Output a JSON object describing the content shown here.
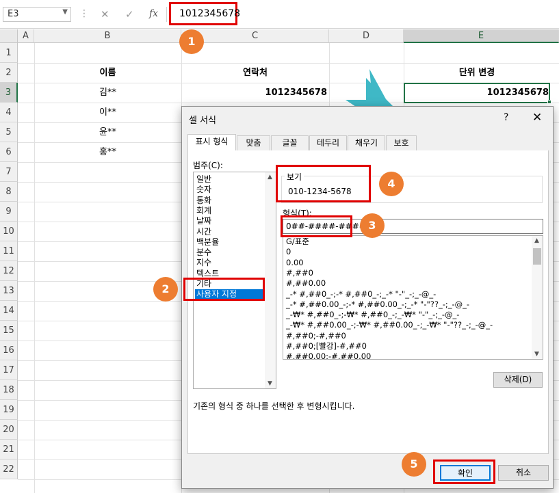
{
  "formula_bar": {
    "name_box": "E3",
    "cancel_icon": "✕",
    "confirm_icon": "✓",
    "fx_label": "fx",
    "value": "1012345678"
  },
  "sheet": {
    "columns": [
      "A",
      "B",
      "C",
      "D",
      "E"
    ],
    "selected_column": "E",
    "rows": [
      "1",
      "2",
      "3",
      "4",
      "5",
      "6",
      "7",
      "8",
      "9",
      "10",
      "11",
      "12",
      "13",
      "14",
      "15",
      "16",
      "17",
      "18",
      "19",
      "20",
      "21",
      "22"
    ],
    "selected_row": "3",
    "headers": {
      "b": "이름",
      "c": "연락처",
      "e": "단위 변경"
    },
    "names": [
      "김**",
      "이**",
      "윤**",
      "홍**"
    ],
    "c3": "1012345678",
    "e3": "1012345678",
    "arrow_color": "#3fb8c6"
  },
  "dialog": {
    "title": "셀 서식",
    "help": "?",
    "close": "✕",
    "tabs": [
      "표시 형식",
      "맞춤",
      "글꼴",
      "테두리",
      "채우기",
      "보호"
    ],
    "active_tab": "표시 형식",
    "category_label": "범주(C):",
    "categories": [
      "일반",
      "숫자",
      "통화",
      "회계",
      "날짜",
      "시간",
      "백분율",
      "분수",
      "지수",
      "텍스트",
      "기타",
      "사용자 지정"
    ],
    "selected_category": "사용자 지정",
    "sample_label": "보기",
    "sample_value": "010-1234-5678",
    "type_label": "형식(T):",
    "type_value": "0##-####-####",
    "formats": [
      "G/표준",
      "0",
      "0.00",
      "#,##0",
      "#,##0.00",
      "_-* #,##0_-;-* #,##0_-;_-* \"-\"_-;_-@_-",
      "_-* #,##0.00_-;-* #,##0.00_-;_-* \"-\"??_-;_-@_-",
      "_-₩* #,##0_-;-₩* #,##0_-;_-₩* \"-\"_-;_-@_-",
      "_-₩* #,##0.00_-;-₩* #,##0.00_-;_-₩* \"-\"??_-;_-@_-",
      "#,##0;-#,##0",
      "#,##0;[빨강]-#,##0",
      "#,##0.00;-#,##0.00"
    ],
    "delete_button": "삭제(D)",
    "description": "기존의 형식 중 하나를 선택한 후 변형시킵니다.",
    "ok_button": "확인",
    "cancel_button": "취소"
  },
  "callouts": [
    "1",
    "2",
    "3",
    "4",
    "5"
  ],
  "colors": {
    "highlight": "#e00000",
    "callout": "#ed7d31",
    "excel_green": "#217346",
    "selection_blue": "#0078d7"
  }
}
